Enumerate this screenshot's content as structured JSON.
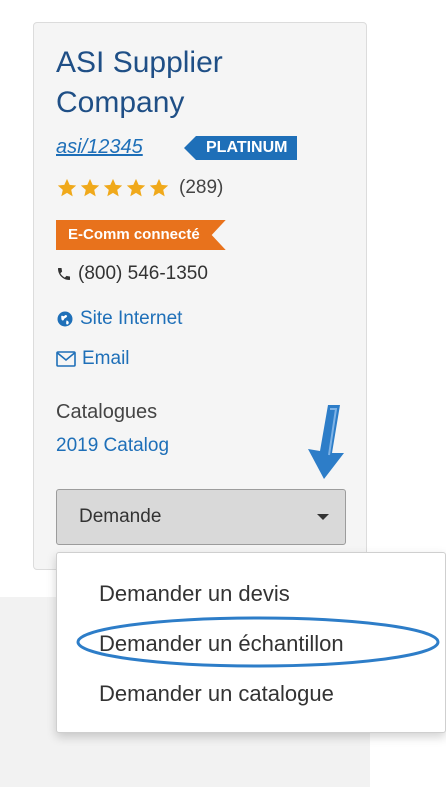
{
  "supplier": {
    "name": "ASI Supplier Company",
    "asi_number": "asi/12345",
    "tier_badge": "PLATINUM",
    "rating_stars": 5,
    "review_count": "(289)",
    "ecomm_badge": "E-Comm connecté",
    "phone": "(800) 546-1350",
    "website_label": "Site Internet",
    "email_label": "Email",
    "catalogues_heading": "Catalogues",
    "catalog_link": "2019 Catalog"
  },
  "action_select": {
    "selected_label": "Demande",
    "options": [
      {
        "label": "Demander un devis"
      },
      {
        "label": "Demander un échantillon"
      },
      {
        "label": "Demander un catalogue"
      }
    ]
  },
  "icons": {
    "star": "star-icon",
    "phone": "phone-icon",
    "globe": "globe-icon",
    "envelope": "envelope-icon",
    "caret": "caret-down-icon",
    "annotation_arrow": "down-arrow-icon"
  },
  "colors": {
    "primary_blue": "#1e6fb8",
    "title_blue": "#1f4f86",
    "star_gold": "#f0a91b",
    "ecomm_orange": "#e8721c",
    "annotation_blue": "#2d7dc8"
  }
}
